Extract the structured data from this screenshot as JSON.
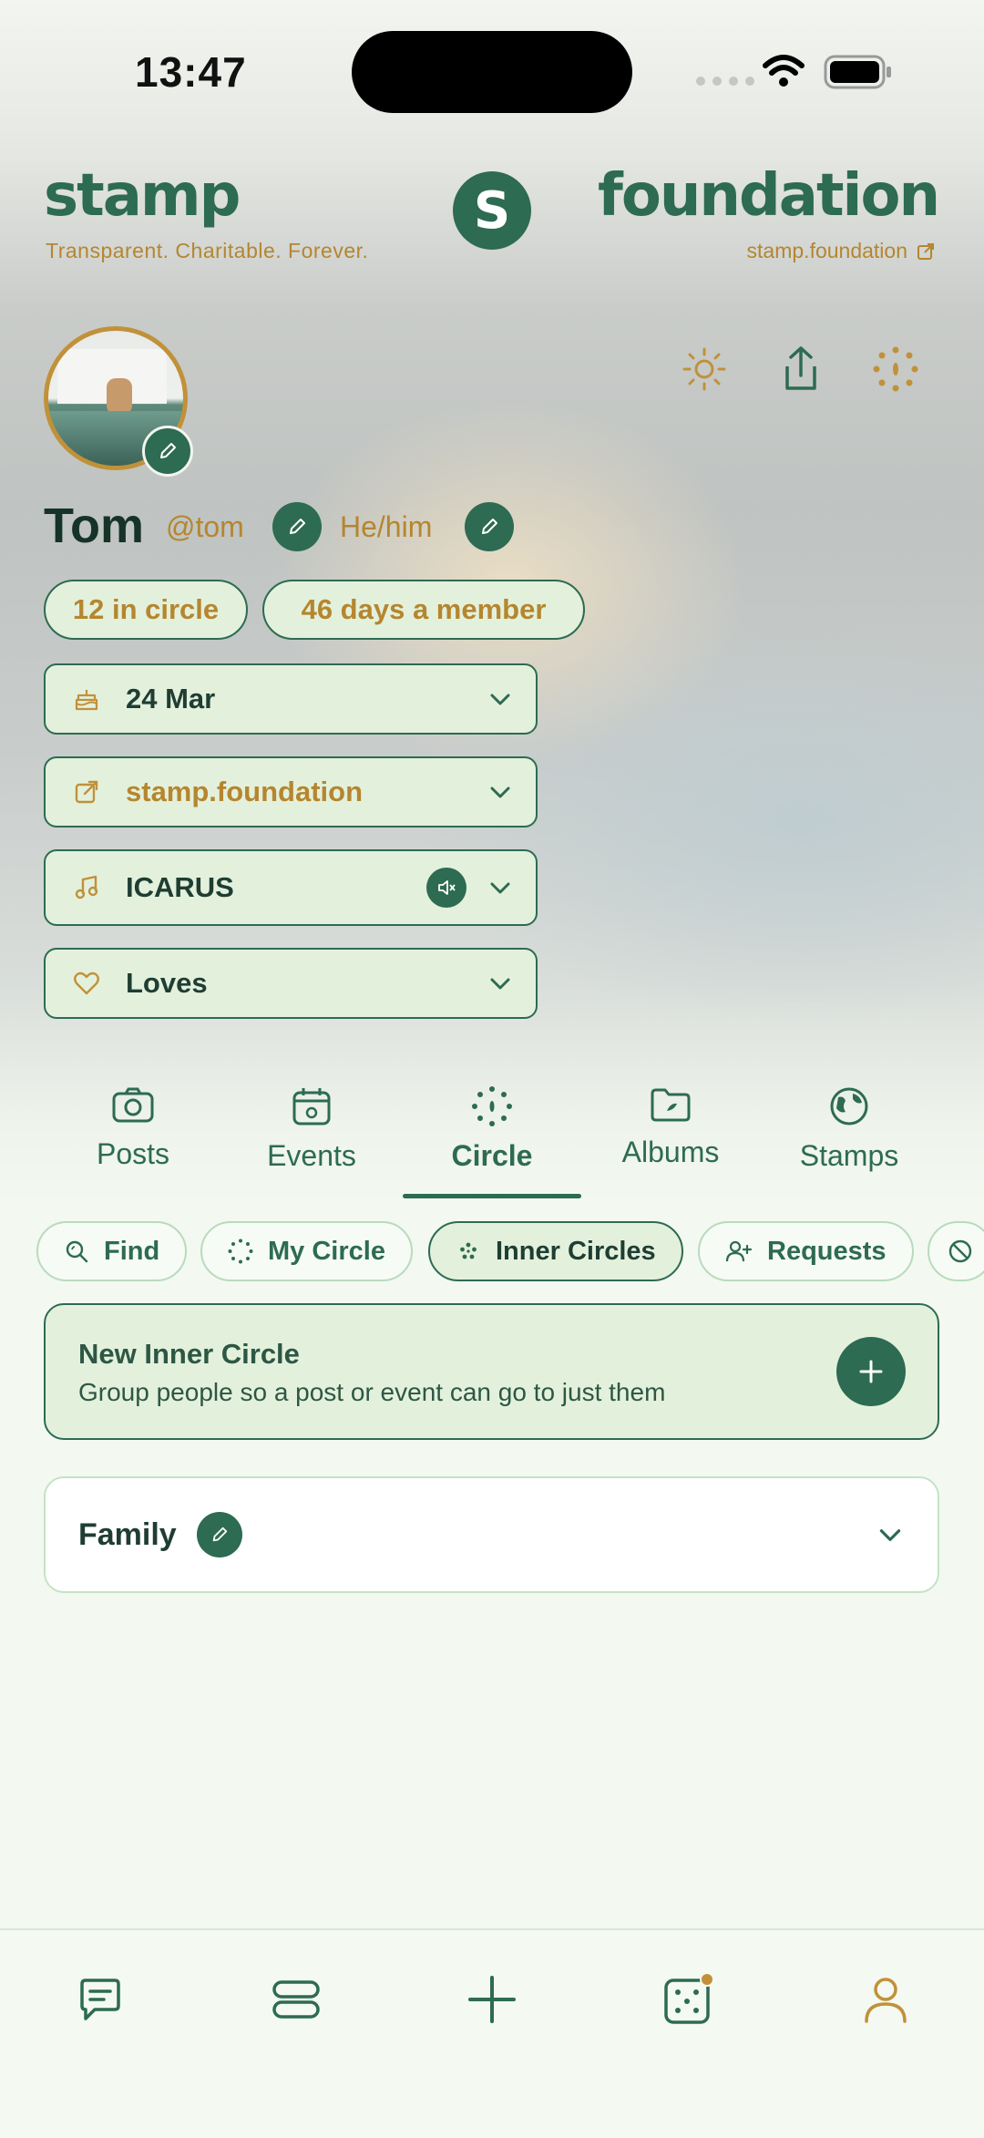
{
  "status": {
    "time": "13:47"
  },
  "brand": {
    "left": "stamp",
    "right": "foundation",
    "logo_letter": "S",
    "tagline": "Transparent. Charitable. Forever.",
    "site": "stamp.foundation"
  },
  "profile": {
    "name": "Tom",
    "handle": "@tom",
    "pronouns": "He/him",
    "chips": [
      "12 in circle",
      "46 days a member"
    ],
    "rows": [
      {
        "icon": "cake-icon",
        "label": "24 Mar"
      },
      {
        "icon": "external-link-icon",
        "label": "stamp.foundation"
      },
      {
        "icon": "music-note-icon",
        "label": "ICARUS"
      },
      {
        "icon": "heart-icon",
        "label": "Loves"
      }
    ]
  },
  "tabs": [
    {
      "label": "Posts",
      "icon": "camera-icon"
    },
    {
      "label": "Events",
      "icon": "calendar-icon"
    },
    {
      "label": "Circle",
      "icon": "dotted-circle-icon",
      "active": true
    },
    {
      "label": "Albums",
      "icon": "folder-icon"
    },
    {
      "label": "Stamps",
      "icon": "globe-icon"
    }
  ],
  "filters": [
    {
      "label": "Find",
      "icon": "search-icon"
    },
    {
      "label": "My Circle",
      "icon": "dotted-circle-icon"
    },
    {
      "label": "Inner Circles",
      "icon": "inner-circle-icon",
      "active": true
    },
    {
      "label": "Requests",
      "icon": "add-person-icon"
    },
    {
      "label": "",
      "icon": "blocked-icon"
    }
  ],
  "new_inner_circle": {
    "title": "New Inner Circle",
    "subtitle": "Group people so a post or event can go to just them"
  },
  "circles": [
    {
      "name": "Family"
    }
  ],
  "colors": {
    "primary": "#2d6b52",
    "accent": "#b5862f",
    "chip_bg": "#e3f1dc"
  },
  "bottom_nav": [
    "chat-icon",
    "feed-icon",
    "plus-icon",
    "dice-icon",
    "profile-icon"
  ]
}
